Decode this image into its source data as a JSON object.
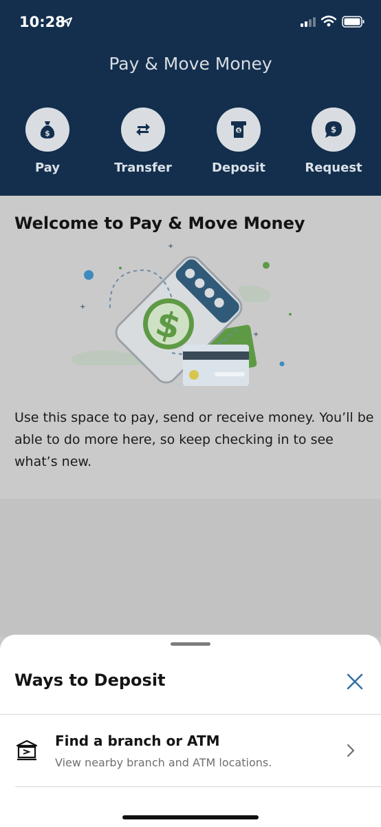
{
  "status_bar": {
    "time": "10:28"
  },
  "header": {
    "title": "Pay & Move Money"
  },
  "actions": [
    {
      "label": "Pay",
      "icon": "money-bag-icon"
    },
    {
      "label": "Transfer",
      "icon": "transfer-arrows-icon"
    },
    {
      "label": "Deposit",
      "icon": "deposit-check-icon"
    },
    {
      "label": "Request",
      "icon": "chat-dollar-icon"
    }
  ],
  "welcome": {
    "title": "Welcome to Pay & Move Money",
    "body": "Use this space to pay, send or receive money. You’ll be able to do more here, so keep checking in to see what’s new.",
    "illustration": "phone-payment-illustration"
  },
  "sheet": {
    "title": "Ways to Deposit",
    "close_icon": "close-icon",
    "items": [
      {
        "title": "Find a branch or ATM",
        "subtitle": "View nearby branch and ATM locations.",
        "icon": "bank-branch-icon"
      }
    ]
  },
  "colors": {
    "header_bg": "#132f4d",
    "accent": "#2e6fa3",
    "green": "#5e9a45",
    "sheet_bg": "#ffffff"
  }
}
